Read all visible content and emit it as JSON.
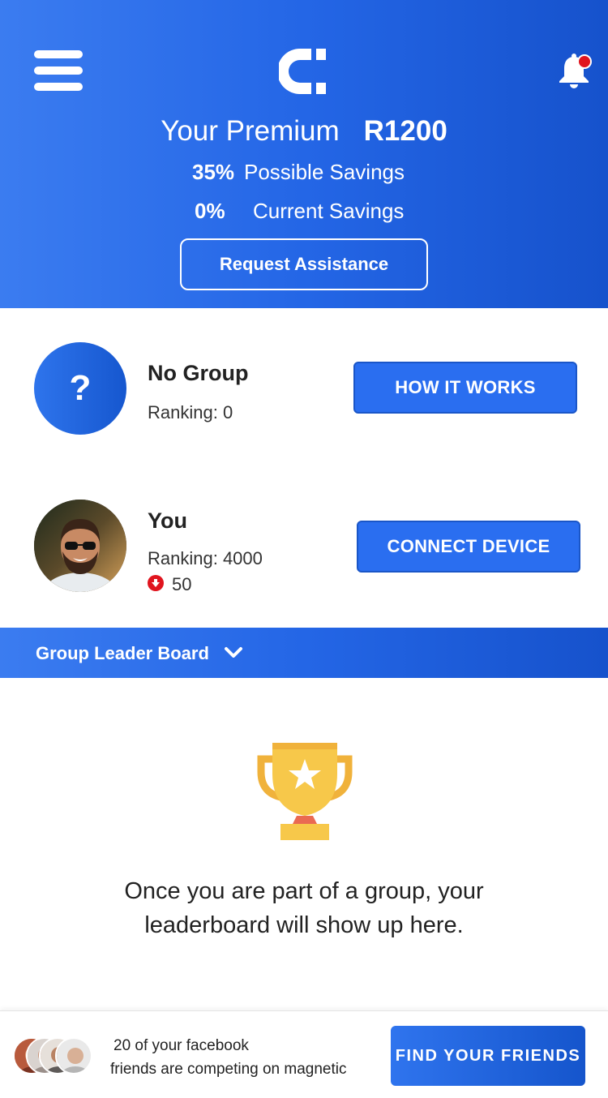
{
  "header": {
    "premium_label": "Your Premium",
    "premium_amount": "R1200",
    "possible_pct": "35%",
    "possible_label": "Possible Savings",
    "current_pct": "0%",
    "current_label": "Current Savings",
    "assist_label": "Request Assistance",
    "icons": {
      "menu": "hamburger-menu-icon",
      "logo": "magnet-logo",
      "bell": "notification-bell-icon"
    },
    "has_notification": true
  },
  "group": {
    "avatar_glyph": "?",
    "name": "No Group",
    "ranking": "Ranking: 0",
    "button_label": "HOW IT WORKS"
  },
  "user": {
    "name": "You",
    "ranking": "Ranking: 4000",
    "change": "50",
    "change_direction": "down",
    "button_label": "CONNECT DEVICE"
  },
  "leaderboard": {
    "title": "Group Leader Board",
    "empty_message": "Once you are part of a group, your leaderboard will show up here."
  },
  "footer": {
    "line1": "20 of your facebook",
    "line2": "friends are competing on magnetic",
    "button_label": "FIND YOUR FRIENDS"
  },
  "colors": {
    "brand_blue": "#2466e6",
    "button_blue": "#2a6ef0",
    "alert_red": "#e0141e",
    "trophy_gold": "#f7c84a"
  }
}
